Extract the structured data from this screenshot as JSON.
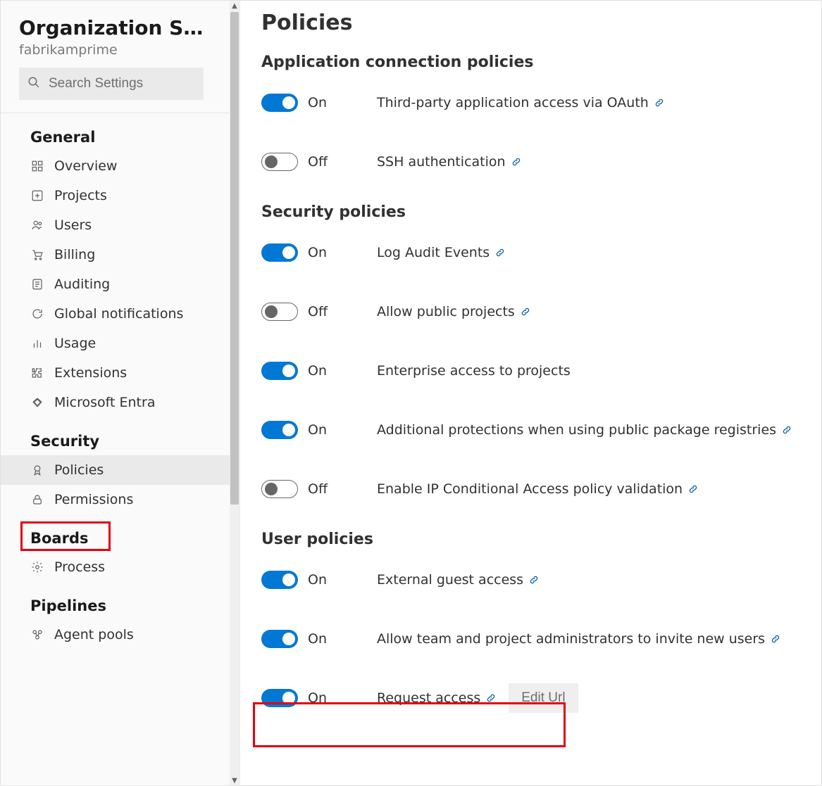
{
  "sidebar": {
    "title": "Organization Settin…",
    "subtitle": "fabrikamprime",
    "searchPlaceholder": "Search Settings",
    "sections": [
      {
        "heading": "General",
        "items": [
          {
            "id": "overview",
            "label": "Overview",
            "icon": "grid-icon"
          },
          {
            "id": "projects",
            "label": "Projects",
            "icon": "plus-box-icon"
          },
          {
            "id": "users",
            "label": "Users",
            "icon": "users-icon"
          },
          {
            "id": "billing",
            "label": "Billing",
            "icon": "cart-icon"
          },
          {
            "id": "auditing",
            "label": "Auditing",
            "icon": "list-icon"
          },
          {
            "id": "global-notifications",
            "label": "Global notifications",
            "icon": "speech-icon"
          },
          {
            "id": "usage",
            "label": "Usage",
            "icon": "bar-chart-icon"
          },
          {
            "id": "extensions",
            "label": "Extensions",
            "icon": "puzzle-icon"
          },
          {
            "id": "microsoft-entra",
            "label": "Microsoft Entra",
            "icon": "entra-icon"
          }
        ]
      },
      {
        "heading": "Security",
        "items": [
          {
            "id": "policies",
            "label": "Policies",
            "icon": "ribbon-icon",
            "selected": true
          },
          {
            "id": "permissions",
            "label": "Permissions",
            "icon": "lock-icon"
          }
        ]
      },
      {
        "heading": "Boards",
        "items": [
          {
            "id": "process",
            "label": "Process",
            "icon": "gear-small-icon"
          }
        ]
      },
      {
        "heading": "Pipelines",
        "items": [
          {
            "id": "agent-pools",
            "label": "Agent pools",
            "icon": "pool-icon"
          }
        ]
      }
    ]
  },
  "main": {
    "title": "Policies",
    "stateLabels": {
      "on": "On",
      "off": "Off"
    },
    "editUrlLabel": "Edit Url",
    "sections": [
      {
        "heading": "Application connection policies",
        "items": [
          {
            "id": "oauth",
            "label": "Third-party application access via OAuth",
            "on": true,
            "link": true
          },
          {
            "id": "ssh",
            "label": "SSH authentication",
            "on": false,
            "link": true
          }
        ]
      },
      {
        "heading": "Security policies",
        "items": [
          {
            "id": "audit",
            "label": "Log Audit Events",
            "on": true,
            "link": true
          },
          {
            "id": "public",
            "label": "Allow public projects",
            "on": false,
            "link": true
          },
          {
            "id": "enterprise",
            "label": "Enterprise access to projects",
            "on": true,
            "link": false
          },
          {
            "id": "pkg",
            "label": "Additional protections when using public package registries",
            "on": true,
            "link": true
          },
          {
            "id": "ipca",
            "label": "Enable IP Conditional Access policy validation",
            "on": false,
            "link": true
          }
        ]
      },
      {
        "heading": "User policies",
        "items": [
          {
            "id": "guest",
            "label": "External guest access",
            "on": true,
            "link": true
          },
          {
            "id": "invite",
            "label": "Allow team and project administrators to invite new users",
            "on": true,
            "link": true
          },
          {
            "id": "request",
            "label": "Request access",
            "on": true,
            "link": true,
            "editUrl": true
          }
        ]
      }
    ]
  }
}
